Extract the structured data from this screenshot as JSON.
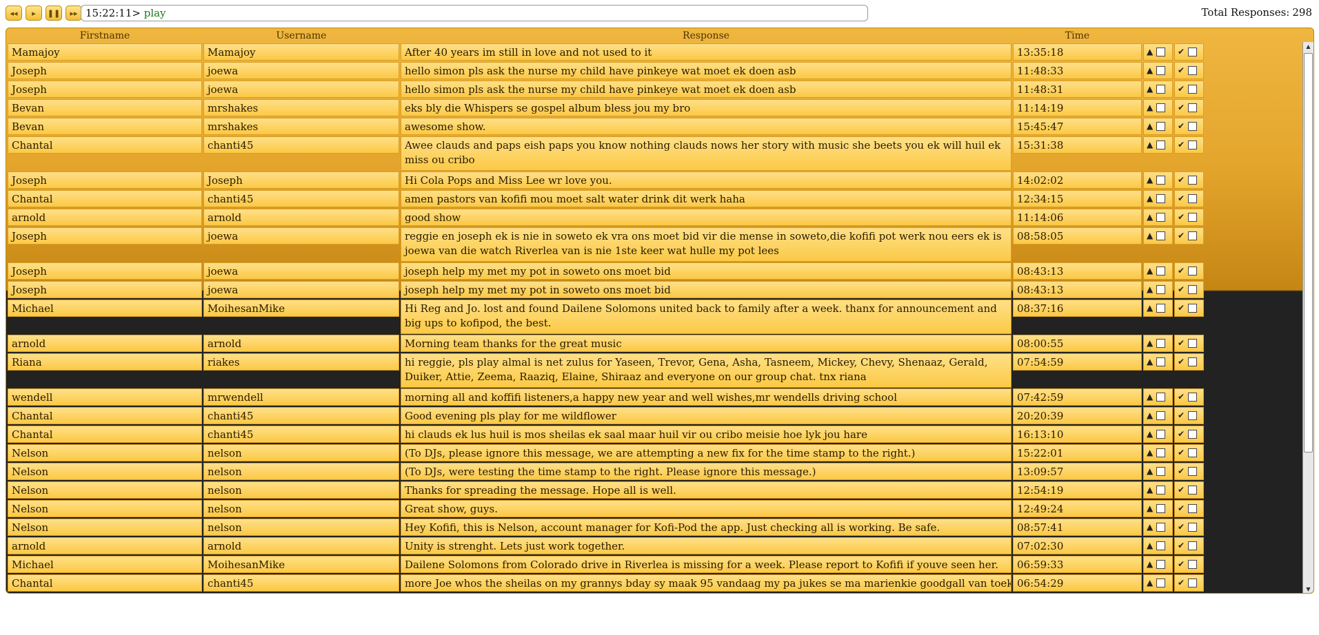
{
  "controls": {
    "rewind": "◂◂",
    "play": "▸",
    "pause": "❚❚",
    "forward": "▸▸"
  },
  "console": {
    "time": "15:22:11>",
    "command": "play"
  },
  "stats": {
    "label": "Total Responses:",
    "value": "298"
  },
  "table": {
    "headers": {
      "firstname": "Firstname",
      "username": "Username",
      "response": "Response",
      "time": "Time"
    },
    "rows": [
      {
        "firstname": "Mamajoy",
        "username": "Mamajoy",
        "response": "After 40 years im still in love and not used to it",
        "time": "13:35:18"
      },
      {
        "firstname": "Joseph",
        "username": "joewa",
        "response": "hello simon pls ask the nurse my child have pinkeye wat moet ek doen asb",
        "time": "11:48:33"
      },
      {
        "firstname": "Joseph",
        "username": "joewa",
        "response": "hello simon pls ask the nurse my child have pinkeye wat moet ek doen asb",
        "time": "11:48:31"
      },
      {
        "firstname": "Bevan",
        "username": "mrshakes",
        "response": "eks bly die Whispers se gospel album bless jou my bro",
        "time": "11:14:19"
      },
      {
        "firstname": "Bevan",
        "username": "mrshakes",
        "response": "awesome show.",
        "time": "15:45:47"
      },
      {
        "firstname": "Chantal",
        "username": "chanti45",
        "response": "Awee clauds and paps eish paps you know nothing clauds nows her story with music she beets you ek will huil ek miss ou cribo",
        "time": "15:31:38",
        "tall": true
      },
      {
        "firstname": "Joseph",
        "username": "Joseph",
        "response": "Hi Cola Pops and Miss Lee wr love you.",
        "time": "14:02:02"
      },
      {
        "firstname": "Chantal",
        "username": "chanti45",
        "response": "amen pastors van kofifi mou moet salt water drink dit werk haha",
        "time": "12:34:15"
      },
      {
        "firstname": "arnold",
        "username": "arnold",
        "response": "good show",
        "time": "11:14:06"
      },
      {
        "firstname": "Joseph",
        "username": "joewa",
        "response": "reggie en joseph ek is nie in soweto ek vra ons moet bid vir die mense in soweto,die kofifi pot werk nou eers ek is joewa van die watch Riverlea van is nie 1ste keer wat hulle my pot lees",
        "time": "08:58:05",
        "tall": true
      },
      {
        "firstname": "Joseph",
        "username": "joewa",
        "response": "joseph help my met my pot in soweto ons moet bid",
        "time": "08:43:13"
      },
      {
        "firstname": "Joseph",
        "username": "joewa",
        "response": "joseph help my met my pot in soweto ons moet bid",
        "time": "08:43:13"
      },
      {
        "firstname": "Michael",
        "username": "MoihesanMike",
        "response": "Hi Reg and Jo. lost and found Dailene Solomons united back to family after a week. thanx for announcement and big ups to kofipod, the best.",
        "time": "08:37:16",
        "tall": true
      },
      {
        "firstname": "arnold",
        "username": "arnold",
        "response": "Morning team thanks for the great music",
        "time": "08:00:55"
      },
      {
        "firstname": "Riana",
        "username": "riakes",
        "response": "hi reggie, pls play almal is net zulus for Yaseen, Trevor, Gena, Asha, Tasneem, Mickey, Chevy, Shenaaz, Gerald, Duiker, Attie, Zeema, Raaziq, Elaine, Shiraaz and everyone on our group chat. tnx riana",
        "time": "07:54:59",
        "tall": true
      },
      {
        "firstname": "wendell",
        "username": "mrwendell",
        "response": "morning all and koffifi listeners,a happy new year and well wishes,mr wendells driving school",
        "time": "07:42:59"
      },
      {
        "firstname": "Chantal",
        "username": "chanti45",
        "response": "Good evening pls play for me wildflower",
        "time": "20:20:39"
      },
      {
        "firstname": "Chantal",
        "username": "chanti45",
        "response": "hi clauds ek lus huil is mos sheilas ek saal maar huil vir ou cribo meisie hoe lyk jou hare",
        "time": "16:13:10"
      },
      {
        "firstname": "Nelson",
        "username": "nelson",
        "response": "(To DJs, please ignore this message, we are attempting a new fix for the time stamp to the right.)",
        "time": "15:22:01"
      },
      {
        "firstname": "Nelson",
        "username": "nelson",
        "response": "(To DJs, were testing the time stamp to the right. Please ignore this message.)",
        "time": "13:09:57"
      },
      {
        "firstname": "Nelson",
        "username": "nelson",
        "response": "Thanks for spreading the message. Hope all is well.",
        "time": "12:54:19"
      },
      {
        "firstname": "Nelson",
        "username": "nelson",
        "response": "Great show, guys.",
        "time": "12:49:24"
      },
      {
        "firstname": "Nelson",
        "username": "nelson",
        "response": "Hey Kofifi, this is Nelson, account manager for Kofi-Pod the app. Just checking all is working. Be safe.",
        "time": "08:57:41"
      },
      {
        "firstname": "arnold",
        "username": "arnold",
        "response": "Unity is strenght. Lets just work together.",
        "time": "07:02:30"
      },
      {
        "firstname": "Michael",
        "username": "MoihesanMike",
        "response": "Dailene Solomons from Colorado drive in Riverlea is missing for a week. Please report to Kofifi if youve seen her.",
        "time": "06:59:33"
      },
      {
        "firstname": "Chantal",
        "username": "chanti45",
        "response": "more Joe whos the sheilas on my grannys bday sy maak 95 vandaag my pa jukes se ma marienkie goodgall van toekies",
        "time": "06:54:29"
      }
    ]
  },
  "icons": {
    "flag": "warning-icon",
    "approve": "check-icon"
  },
  "colors": {
    "cell": "#fbc945",
    "panel": "#e4a52c",
    "console_cmd": "#1a7a1a"
  }
}
